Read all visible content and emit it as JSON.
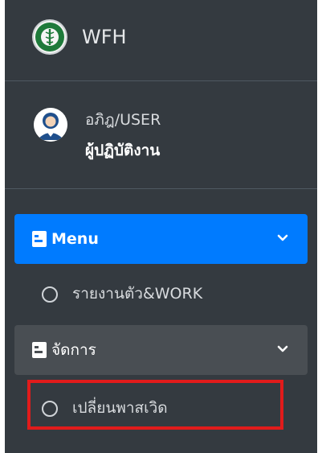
{
  "brand": {
    "title": "WFH",
    "logo_icon": "moph-caduceus-logo"
  },
  "user": {
    "name": "อภิฎ/USER",
    "role": "ผู้ปฏิบัติงาน",
    "avatar_icon": "user-avatar-icon"
  },
  "nav": {
    "menu": {
      "label": "Menu",
      "icon": "address-card-icon",
      "items": [
        {
          "label": "รายงานตัว&WORK",
          "icon": "circle-icon"
        }
      ]
    },
    "manage": {
      "label": "จัดการ",
      "icon": "address-card-icon",
      "items": [
        {
          "label": "เปลี่ยนพาสเวิด",
          "icon": "circle-icon"
        }
      ]
    }
  },
  "colors": {
    "sidebar_bg": "#343a40",
    "active_bg": "#007bff",
    "group_bg": "#494e53",
    "highlight": "#e11b1b"
  }
}
